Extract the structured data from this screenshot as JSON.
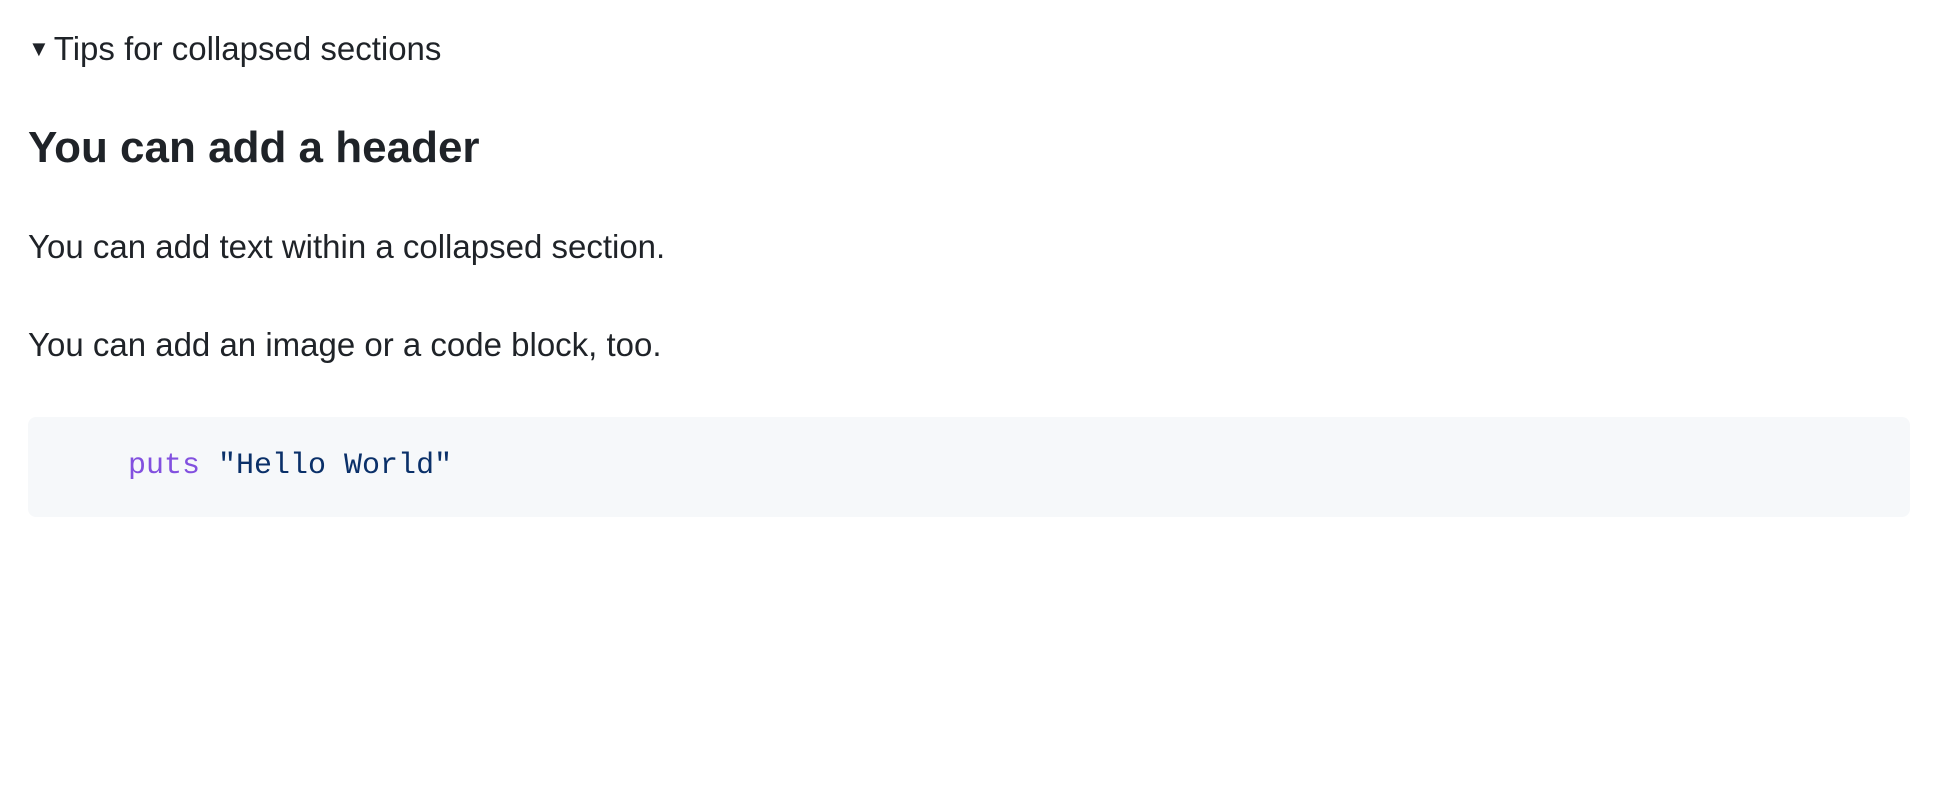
{
  "summary": {
    "label": "Tips for collapsed sections"
  },
  "header": {
    "text": "You can add a header"
  },
  "paragraphs": {
    "p1": "You can add text within a collapsed section.",
    "p2": "You can add an image or a code block, too."
  },
  "code": {
    "keyword": "puts",
    "space": " ",
    "string": "\"Hello World\""
  }
}
